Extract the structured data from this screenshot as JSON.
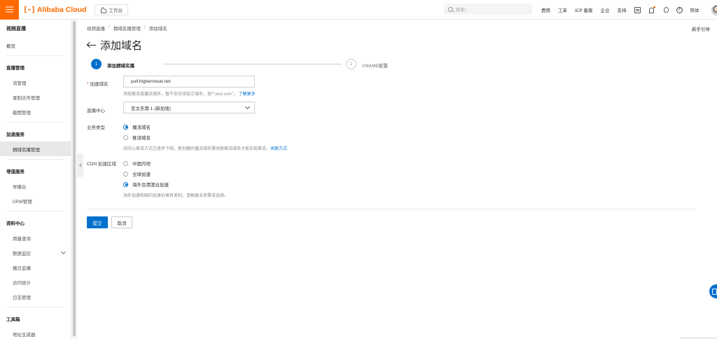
{
  "colors": {
    "brand": "#ff6a00",
    "primary": "#0070cc"
  },
  "topbar": {
    "logo_text": "Alibaba Cloud",
    "workbench_label": "工作台",
    "search_placeholder": "搜索...",
    "nav": [
      "费用",
      "工单",
      "ICP 备案",
      "企业",
      "支持"
    ],
    "lang": "简体",
    "icons": [
      "message-icon",
      "bell-icon",
      "bulb-icon",
      "help-icon",
      "avatar"
    ]
  },
  "sidebar": {
    "title": "视频直播",
    "overview": "概览",
    "sections": [
      {
        "title": "直播管理",
        "items": [
          "流管理",
          "录制文件管理",
          "截图管理"
        ]
      },
      {
        "title": "加速服务",
        "items": [
          "拥域名播管理"
        ]
      },
      {
        "title": "增值服务",
        "items": [
          "导播台",
          "DRM管理"
        ]
      },
      {
        "title": "资料中心",
        "items": [
          "用量查询",
          "数据监控",
          "播日监播",
          "访问统计",
          "日志管理"
        ]
      },
      {
        "title": "工具箱",
        "items": [
          "地址生成器"
        ]
      }
    ],
    "active_item": "拥域名播管理"
  },
  "breadcrumb": [
    "视频直播",
    "拥域名播管理",
    "添加域名"
  ],
  "newbie_guide": "新手引导",
  "page_title": "添加域名",
  "steps": [
    {
      "num": "1",
      "label": "添加拥域名播"
    },
    {
      "num": "2",
      "label": "CNAME配置"
    }
  ],
  "form": {
    "domain_label": "加速域名",
    "domain_value": "pull.highercloud.net",
    "domain_help": "添加推流或播流域名，暂不支持添加泛域名，如\"*.test.com\"，",
    "domain_help_link": "了解更多",
    "region_label": "直播中心",
    "region_value": "亚太东南 1 (新加坡)",
    "type_label": "业务类型",
    "type_options": [
      "播流域名",
      "推流域名"
    ],
    "type_help": "旧中心推流方式已逐步下线，新创建的播流域名需关联推流域名才能实现推流。",
    "type_help_link": "关联方式",
    "cdn_label": "CDN 加速区域",
    "cdn_options": [
      "中国内地",
      "全球加速",
      "海外及港澳台加速"
    ],
    "cdn_help": "海外加速和国内加速价格有差别，请根据业务需求选择。",
    "selected_type": "播流域名",
    "selected_cdn": "海外及港澳台加速"
  },
  "buttons": {
    "submit": "提交",
    "cancel": "取消"
  }
}
